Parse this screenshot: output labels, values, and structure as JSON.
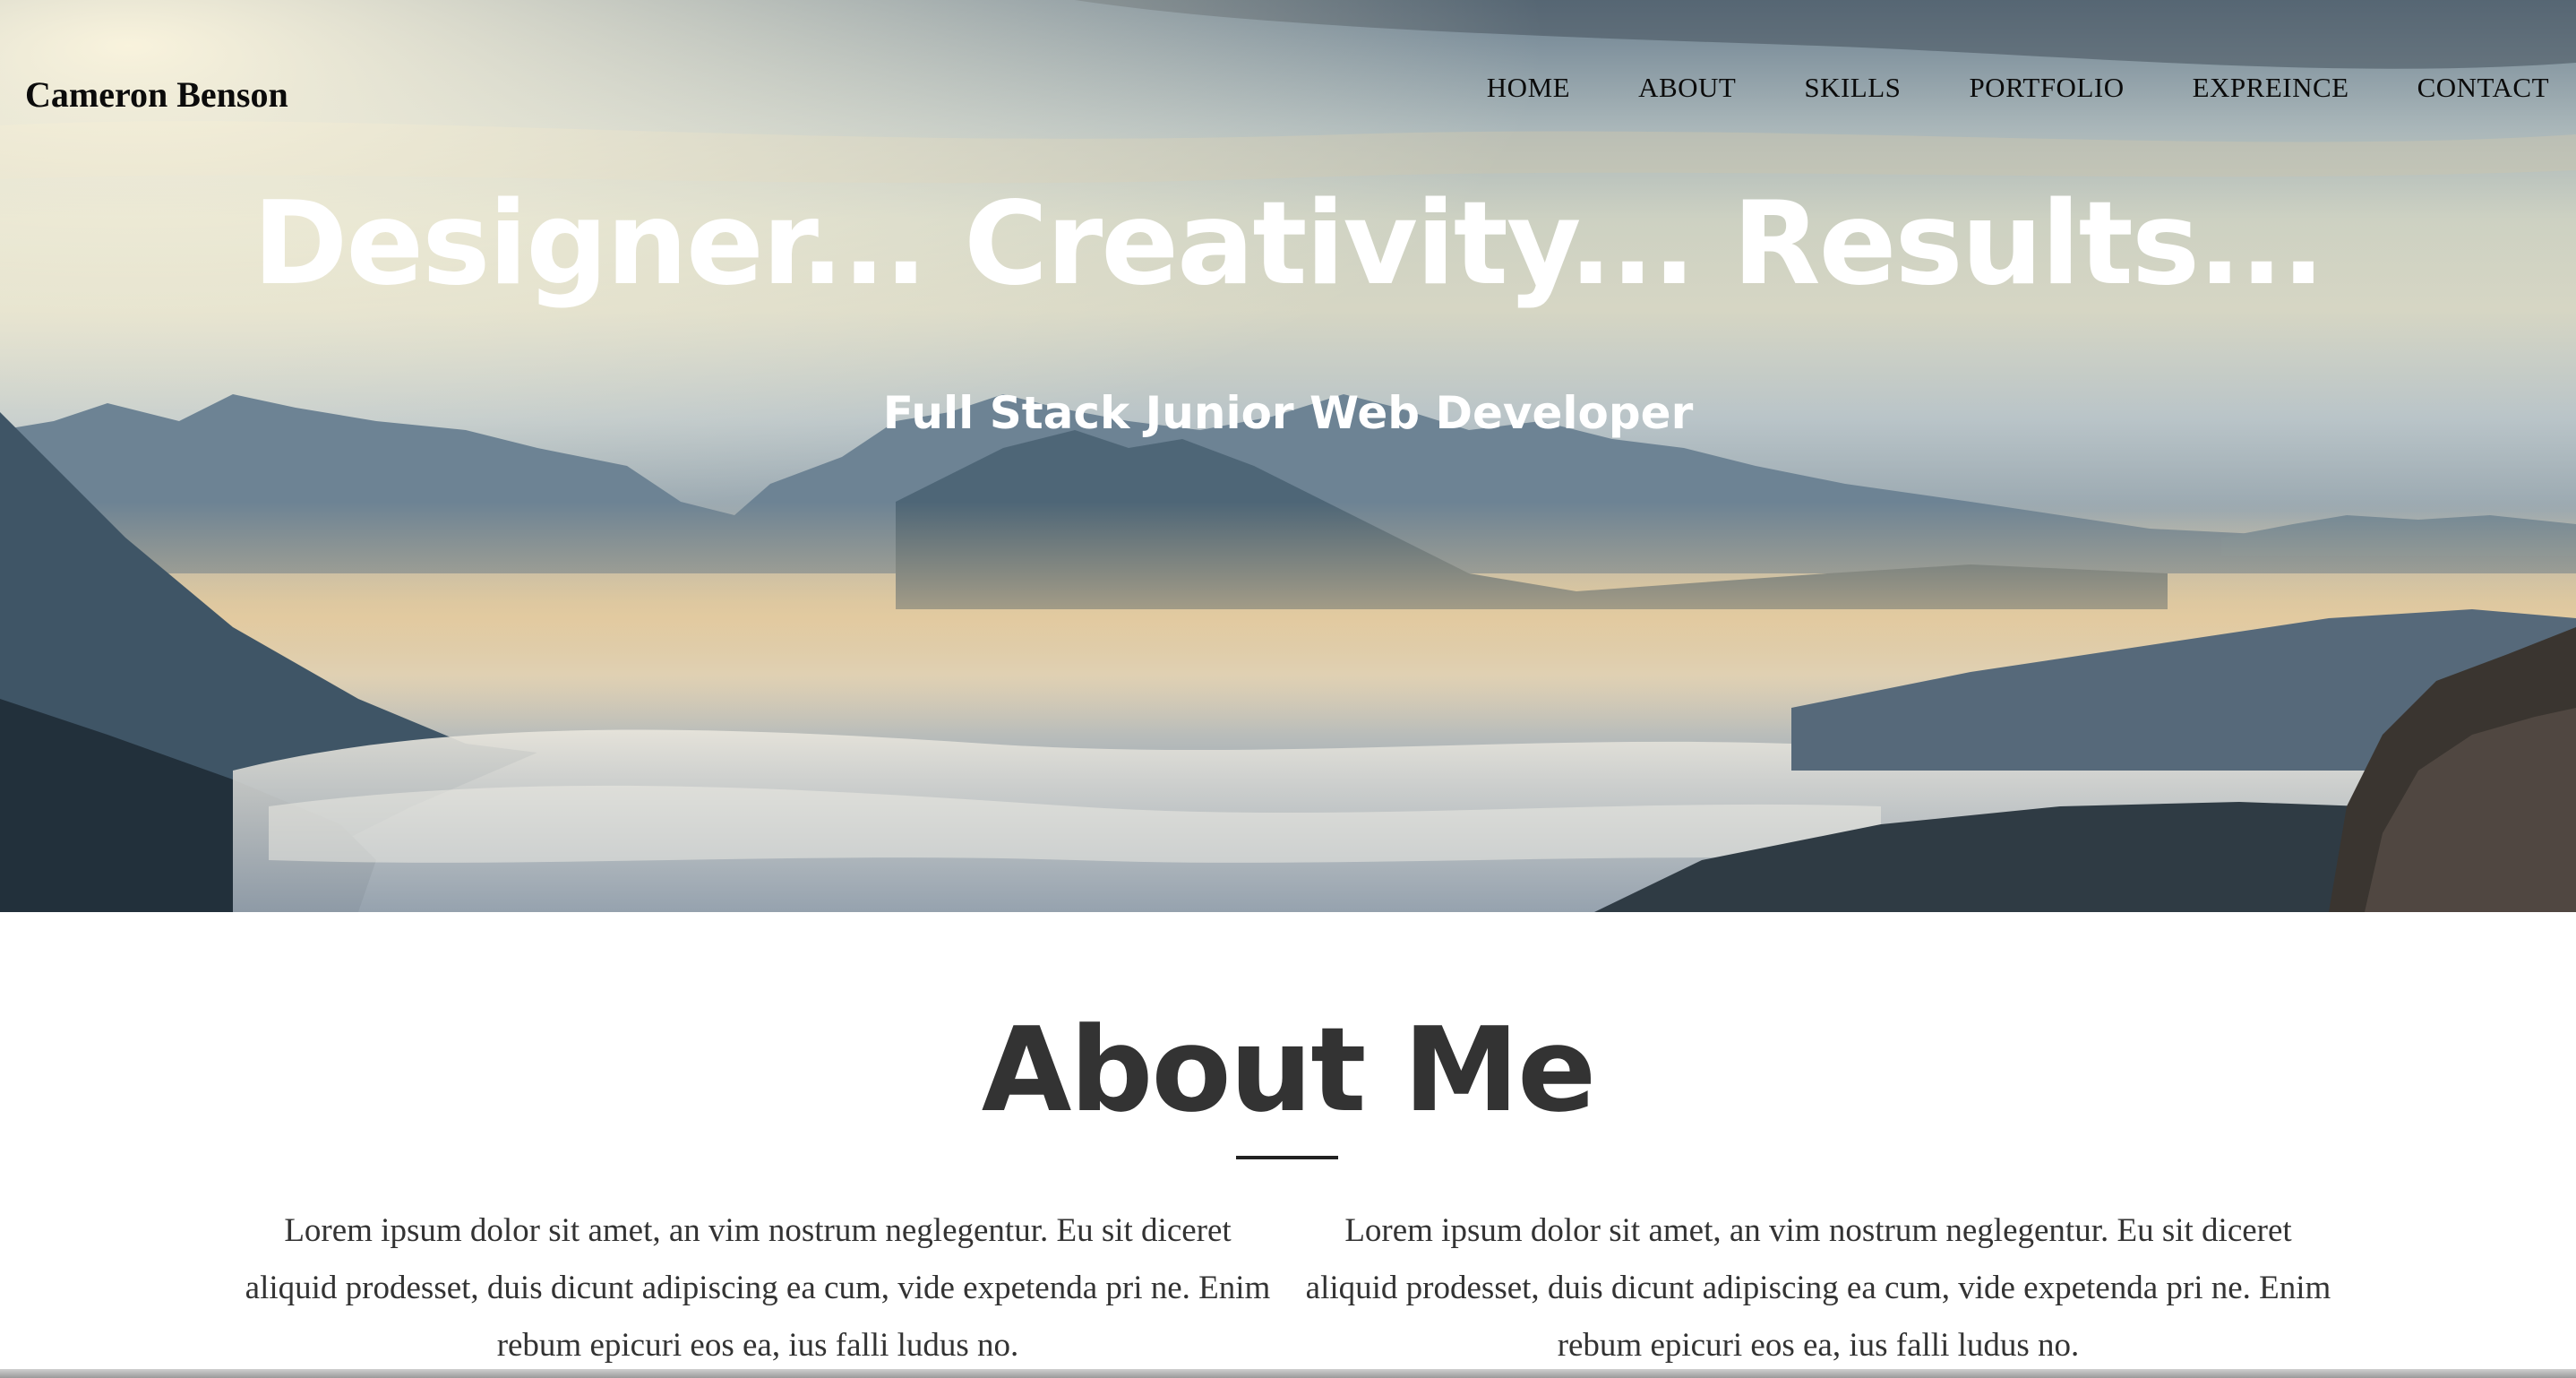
{
  "brand": "Cameron Benson",
  "nav": {
    "items": [
      "HOME",
      "ABOUT",
      "SKILLS",
      "PORTFOLIO",
      "EXPREINCE",
      "CONTACT"
    ]
  },
  "hero": {
    "title": "Designer... Creativity... Results...",
    "subtitle": "Full Stack Junior Web Developer",
    "background": "mountain-sea-of-clouds-photo"
  },
  "about": {
    "title": "About Me",
    "columns": [
      "Lorem ipsum dolor sit amet, an vim nostrum neglegentur. Eu sit diceret aliquid prodesset, duis dicunt adipiscing ea cum, vide expetenda pri ne. Enim rebum epicuri eos ea, ius falli ludus no.",
      "Lorem ipsum dolor sit amet, an vim nostrum neglegentur. Eu sit diceret aliquid prodesset, duis dicunt adipiscing ea cum, vide expetenda pri ne. Enim rebum epicuri eos ea, ius falli ludus no."
    ]
  },
  "colors": {
    "text_dark": "#333333",
    "nav_text": "#0b0b0b",
    "hero_text": "#ffffff"
  }
}
